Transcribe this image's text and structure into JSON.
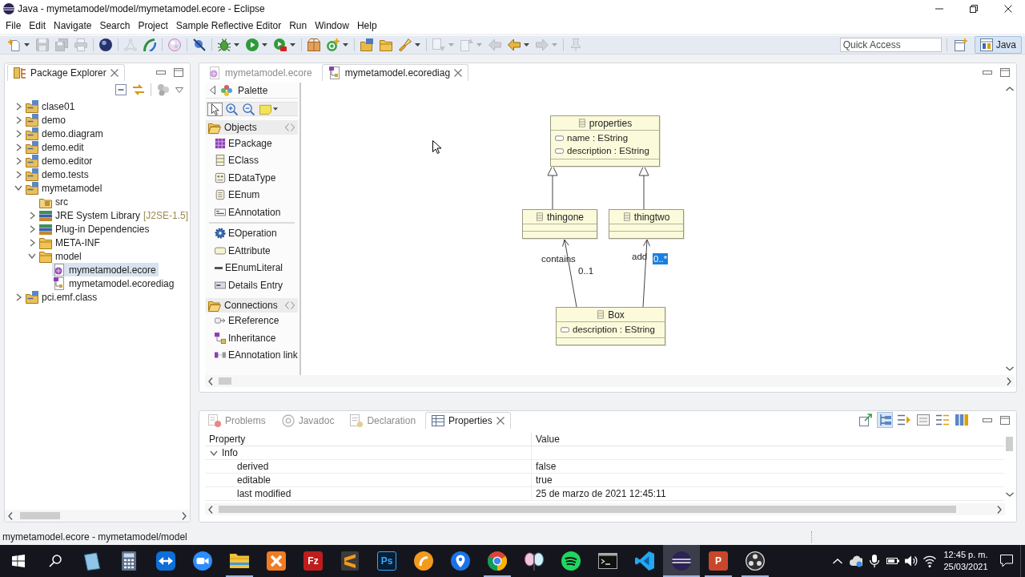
{
  "window": {
    "title": "Java - mymetamodel/model/mymetamodel.ecore - Eclipse"
  },
  "menu": [
    "File",
    "Edit",
    "Navigate",
    "Search",
    "Project",
    "Sample Reflective Editor",
    "Run",
    "Window",
    "Help"
  ],
  "toolbar": {
    "groups": [
      [
        {
          "kind": "new",
          "dropdown": true,
          "disabled": false
        },
        {
          "kind": "save",
          "disabled": true
        },
        {
          "kind": "saveall",
          "disabled": true
        },
        {
          "kind": "print",
          "disabled": true
        }
      ],
      [
        {
          "kind": "sphere",
          "disabled": false
        }
      ],
      [
        {
          "kind": "nodes",
          "disabled": true
        },
        {
          "kind": "arc",
          "disabled": false
        }
      ],
      [
        {
          "kind": "glossy",
          "disabled": false
        }
      ],
      [
        {
          "kind": "skip",
          "disabled": false
        }
      ],
      [
        {
          "kind": "debug",
          "dropdown": true,
          "disabled": false
        },
        {
          "kind": "run",
          "dropdown": true,
          "disabled": false
        },
        {
          "kind": "runext",
          "dropdown": true,
          "disabled": false
        }
      ],
      [
        {
          "kind": "package",
          "disabled": false
        },
        {
          "kind": "newclass",
          "dropdown": true,
          "disabled": false
        }
      ],
      [
        {
          "kind": "opentype",
          "disabled": false
        },
        {
          "kind": "openfolder",
          "disabled": false
        },
        {
          "kind": "search",
          "dropdown": true,
          "disabled": false
        }
      ],
      [
        {
          "kind": "nextann",
          "dropdown": true,
          "disabled": true
        },
        {
          "kind": "prevann",
          "dropdown": true,
          "disabled": true
        },
        {
          "kind": "lastedit",
          "disabled": true
        },
        {
          "kind": "back",
          "dropdown": true,
          "disabled": false
        },
        {
          "kind": "forward",
          "dropdown": true,
          "disabled": true
        }
      ],
      [
        {
          "kind": "pin",
          "disabled": true
        }
      ]
    ],
    "quick_access": {
      "placeholder": "Quick Access"
    },
    "perspective": {
      "label": "Java",
      "selected": true
    }
  },
  "package_explorer": {
    "title": "Package Explorer",
    "tree": [
      {
        "label": "clase01",
        "kind": "project",
        "expanded": false,
        "selected": false
      },
      {
        "label": "demo",
        "kind": "project",
        "expanded": false,
        "selected": false
      },
      {
        "label": "demo.diagram",
        "kind": "project",
        "expanded": false,
        "selected": false
      },
      {
        "label": "demo.edit",
        "kind": "project",
        "expanded": false,
        "selected": false
      },
      {
        "label": "demo.editor",
        "kind": "project",
        "expanded": false,
        "selected": false
      },
      {
        "label": "demo.tests",
        "kind": "project",
        "expanded": false,
        "selected": false
      },
      {
        "label": "mymetamodel",
        "kind": "project",
        "expanded": true,
        "selected": false,
        "children": [
          {
            "label": "src",
            "kind": "source",
            "selected": false
          },
          {
            "label": "JRE System Library",
            "decoration": "[J2SE-1.5]",
            "kind": "library",
            "expanded": false,
            "selected": false
          },
          {
            "label": "Plug-in Dependencies",
            "kind": "library",
            "expanded": false,
            "selected": false
          },
          {
            "label": "META-INF",
            "kind": "folder",
            "expanded": false,
            "selected": false
          },
          {
            "label": "model",
            "kind": "folder",
            "expanded": true,
            "selected": false,
            "children": [
              {
                "label": "mymetamodel.ecore",
                "kind": "ecore",
                "selected": true
              },
              {
                "label": "mymetamodel.ecorediag",
                "kind": "diagram",
                "selected": false
              }
            ]
          }
        ]
      },
      {
        "label": "pci.emf.class",
        "kind": "project",
        "expanded": false,
        "selected": false
      }
    ]
  },
  "editor": {
    "tabs": [
      {
        "label": "mymetamodel.ecore",
        "kind": "ecore",
        "selected": false
      },
      {
        "label": "mymetamodel.ecorediag",
        "kind": "diagram",
        "selected": true
      }
    ],
    "palette": {
      "title": "Palette",
      "tools": [
        {
          "kind": "select",
          "selected": true
        },
        {
          "kind": "zoomin",
          "selected": false
        },
        {
          "kind": "zoomout",
          "selected": false
        },
        {
          "kind": "note",
          "selected": false,
          "dropdown": true
        }
      ],
      "drawers": [
        {
          "label": "Objects",
          "expanded": true,
          "groups": [
            [
              {
                "label": "EPackage",
                "kind": "package",
                "selected": false
              },
              {
                "label": "EClass",
                "kind": "class",
                "selected": false
              },
              {
                "label": "EDataType",
                "kind": "datatype",
                "selected": false
              },
              {
                "label": "EEnum",
                "kind": "enum",
                "selected": false
              },
              {
                "label": "EAnnotation",
                "kind": "annotation",
                "selected": false
              }
            ],
            [
              {
                "label": "EOperation",
                "kind": "operation",
                "selected": false
              },
              {
                "label": "EAttribute",
                "kind": "attribute",
                "selected": false
              },
              {
                "label": "EEnumLiteral",
                "kind": "literal",
                "selected": false
              },
              {
                "label": "Details Entry",
                "kind": "entry",
                "selected": false
              }
            ]
          ]
        },
        {
          "label": "Connections",
          "expanded": true,
          "groups": [
            [
              {
                "label": "EReference",
                "kind": "reference",
                "selected": false
              },
              {
                "label": "Inheritance",
                "kind": "inheritance",
                "selected": false
              },
              {
                "label": "EAnnotation link",
                "kind": "annotationlink",
                "selected": false
              }
            ]
          ]
        }
      ]
    },
    "diagram": {
      "classes": [
        {
          "name": "properties",
          "attributes": [
            "name : EString",
            "description : EString"
          ]
        },
        {
          "name": "thingone"
        },
        {
          "name": "thingtwo"
        },
        {
          "name": "Box",
          "attributes": [
            "description : EString"
          ]
        }
      ],
      "references": [
        {
          "label": "contains",
          "multiplicity": "0..1",
          "selected": false
        },
        {
          "label": "add",
          "multiplicity": "0..*",
          "selected": true
        }
      ]
    }
  },
  "properties_view": {
    "tabs": [
      {
        "label": "Problems",
        "kind": "problems",
        "selected": false
      },
      {
        "label": "Javadoc",
        "kind": "javadoc",
        "selected": false
      },
      {
        "label": "Declaration",
        "kind": "declaration",
        "selected": false
      },
      {
        "label": "Properties",
        "kind": "properties",
        "selected": true
      }
    ],
    "tools": [
      {
        "kind": "pin",
        "on": false
      },
      {
        "kind": "categories",
        "on": true
      },
      {
        "kind": "advanced",
        "on": false
      },
      {
        "kind": "defaults",
        "on": false
      },
      {
        "kind": "filter",
        "on": false
      },
      {
        "kind": "columns",
        "on": false
      }
    ],
    "columns": [
      "Property",
      "Value"
    ],
    "groups": [
      {
        "label": "Info",
        "expanded": true,
        "rows": [
          {
            "property": "derived",
            "value": "false"
          },
          {
            "property": "editable",
            "value": "true"
          },
          {
            "property": "last modified",
            "value": "25 de marzo de 2021 12:45:11"
          }
        ]
      }
    ]
  },
  "status_bar": {
    "text": "mymetamodel.ecore - mymetamodel/model"
  },
  "taskbar": {
    "apps": [
      {
        "kind": "note",
        "running": false,
        "active": false
      },
      {
        "kind": "calculator",
        "running": false,
        "active": false
      },
      {
        "kind": "remote",
        "running": false,
        "active": false
      },
      {
        "kind": "camera",
        "running": false,
        "active": false
      },
      {
        "kind": "files",
        "running": true,
        "active": false
      },
      {
        "kind": "xtile",
        "running": false,
        "active": false
      },
      {
        "kind": "ztile",
        "glyph": "Fz",
        "running": false,
        "active": false
      },
      {
        "kind": "stile",
        "running": false,
        "active": false
      },
      {
        "kind": "pstile",
        "glyph": "Ps",
        "running": false,
        "active": false
      },
      {
        "kind": "pcircle",
        "running": false,
        "active": false
      },
      {
        "kind": "mappin",
        "running": false,
        "active": false
      },
      {
        "kind": "browser",
        "running": true,
        "active": false
      },
      {
        "kind": "butterfly",
        "running": false,
        "active": false
      },
      {
        "kind": "music",
        "running": false,
        "active": false
      },
      {
        "kind": "terminal",
        "running": false,
        "active": false
      },
      {
        "kind": "code",
        "running": false,
        "active": false
      },
      {
        "kind": "sphere",
        "running": true,
        "active": true
      },
      {
        "kind": "slides",
        "glyph": "P",
        "running": true,
        "active": false
      },
      {
        "kind": "recorder",
        "running": true,
        "active": false
      }
    ],
    "clock": {
      "time": "12:45 p. m.",
      "date": "25/03/2021"
    }
  }
}
